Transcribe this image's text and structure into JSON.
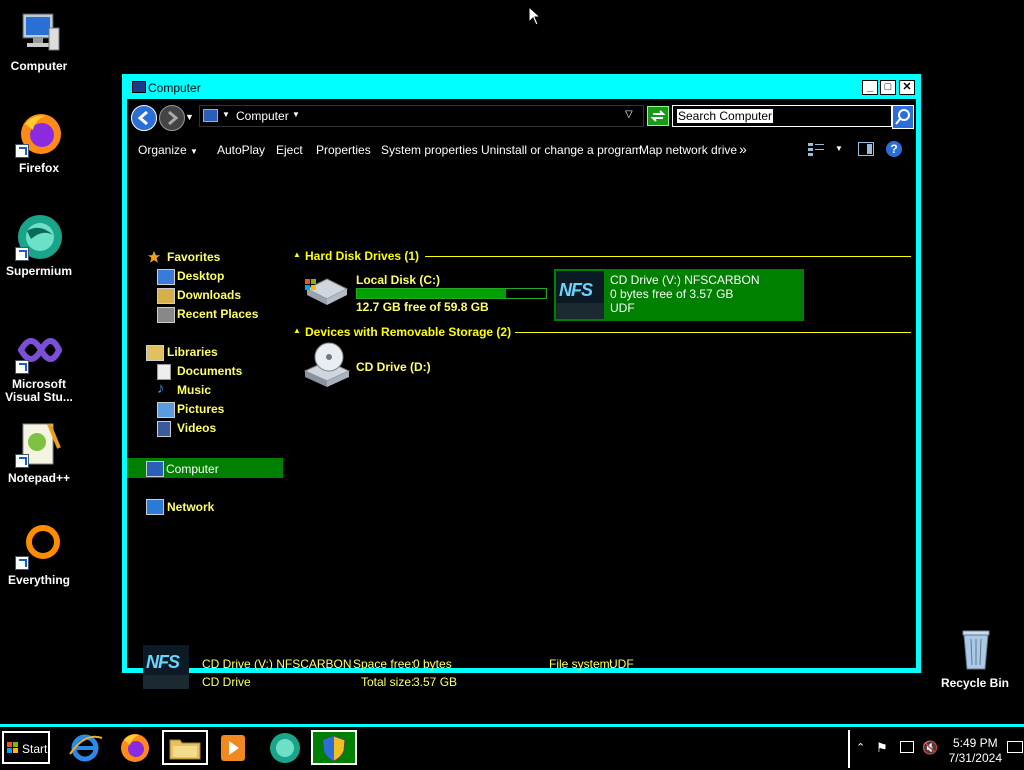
{
  "desktop": {
    "icons": [
      {
        "label": "Computer"
      },
      {
        "label": "Firefox"
      },
      {
        "label": "Supermium"
      },
      {
        "label": "Microsoft Visual Stu..."
      },
      {
        "label": "Notepad++"
      },
      {
        "label": "Everything"
      },
      {
        "label": "Recycle Bin"
      }
    ]
  },
  "window": {
    "title": "Computer",
    "buttons": {
      "minimize": "_",
      "maximize": "□",
      "close": "✕"
    },
    "address": {
      "location": "Computer"
    },
    "search": {
      "placeholder": "Search Computer"
    },
    "toolbar": {
      "items": [
        "Organize",
        "AutoPlay",
        "Eject",
        "Properties",
        "System properties",
        "Uninstall or change a program",
        "Map network drive"
      ],
      "more": "»"
    },
    "nav": {
      "favorites": "Favorites",
      "favorites_items": [
        "Desktop",
        "Downloads",
        "Recent Places"
      ],
      "libraries": "Libraries",
      "libraries_items": [
        "Documents",
        "Music",
        "Pictures",
        "Videos"
      ],
      "computer": "Computer",
      "network": "Network"
    },
    "content": {
      "groups": [
        {
          "header": "Hard Disk Drives (1)"
        },
        {
          "header": "Devices with Removable Storage (2)"
        }
      ],
      "local_disk": {
        "name": "Local Disk (C:)",
        "free": "12.7 GB free of 59.8 GB",
        "used_fraction": 0.79
      },
      "cd_drive_d": {
        "name": "CD Drive (D:)"
      },
      "cd_drive_v": {
        "name": "CD Drive (V:) NFSCARBON",
        "free": "0 bytes free of 3.57 GB",
        "fs": "UDF",
        "logo_text": "NFS"
      }
    },
    "details": {
      "name": "CD Drive (V:) NFSCARBON",
      "type": "CD Drive",
      "space_free_label": "Space free:",
      "space_free_value": "0 bytes",
      "total_size_label": "Total size:",
      "total_size_value": "3.57 GB",
      "fs_label": "File system:",
      "fs_value": "UDF"
    }
  },
  "taskbar": {
    "start": "Start",
    "clock_time": "5:49 PM",
    "clock_date": "7/31/2024"
  },
  "colors": {
    "accent": "#00ffff",
    "text": "#ffff66",
    "selection": "#008000"
  }
}
